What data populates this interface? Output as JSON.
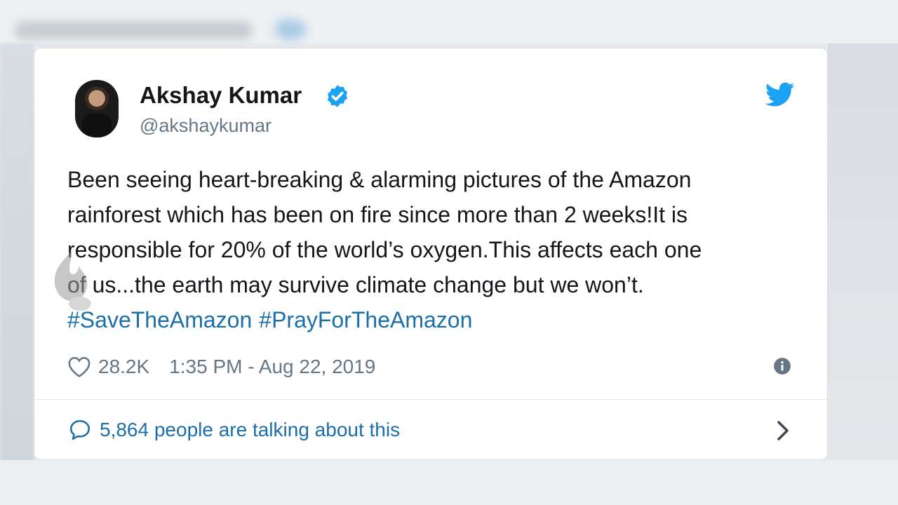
{
  "tweet": {
    "author_name": "Akshay Kumar",
    "handle": "@akshaykumar",
    "text_lines": [
      "Been seeing heart-breaking & alarming pictures of the Amazon",
      "rainforest which has been on fire since more than 2 weeks!It is",
      "responsible for 20% of the world’s oxygen.This affects each one",
      "of us...the earth may survive climate change but we won’t."
    ],
    "hashtags": [
      "#SaveTheAmazon",
      "#PrayForTheAmazon"
    ],
    "likes": "28.2K",
    "timestamp": "1:35 PM - Aug 22, 2019",
    "talking_about": "5,864 people are talking about this"
  },
  "colors": {
    "link": "#1b6fa8",
    "twitter_blue": "#1da1f2",
    "muted": "#657786",
    "text": "#14171a"
  },
  "icons": [
    "verified-badge-icon",
    "twitter-bird-icon",
    "heart-icon",
    "info-icon",
    "comment-bubble-icon",
    "chevron-right-icon"
  ]
}
